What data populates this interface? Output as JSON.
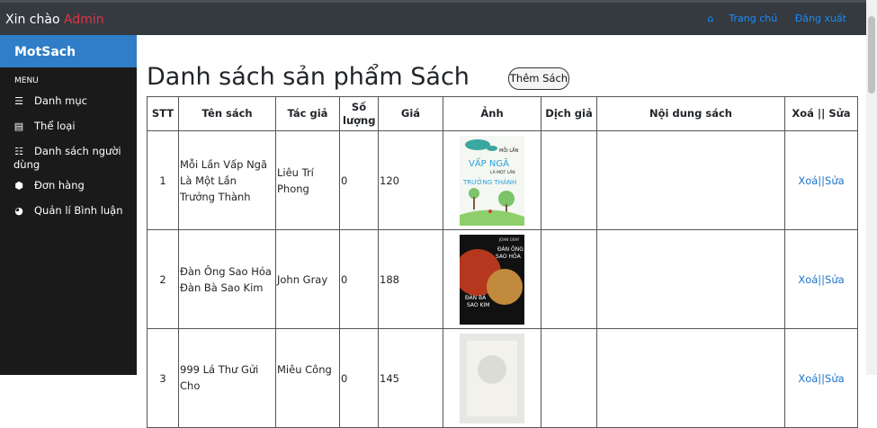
{
  "header": {
    "greeting": "Xin chào",
    "user": "Admin",
    "nav": [
      "Trang chủ",
      "Đăng xuất"
    ]
  },
  "sidebar": {
    "brand": "MotSach",
    "menu_heading": "MENU",
    "items": [
      {
        "label": "Danh mục",
        "icon": "list-icon"
      },
      {
        "label": "Thể loại",
        "icon": "category-icon"
      },
      {
        "label": "Danh sách người dùng",
        "icon": "users-list-icon"
      },
      {
        "label": "Đơn hàng",
        "icon": "order-icon"
      },
      {
        "label": "Quản lí Bình luận",
        "icon": "comments-icon"
      }
    ]
  },
  "main": {
    "title": "Danh sách sản phẩm Sách",
    "add_button": "Thêm Sách",
    "columns": [
      "STT",
      "Tên sách",
      "Tác giả",
      "Số lượng",
      "Giá",
      "Ảnh",
      "Dịch giả",
      "Nội dung sách",
      "Xoá || Sửa"
    ],
    "rows": [
      {
        "stt": "1",
        "name": "Mỗi Lần Vấp Ngã Là Một Lần Trưởng Thành",
        "author": "Liêu Trí Phong",
        "qty": "0",
        "price": "120",
        "cover_text": [
          "MỖI LẦN",
          "VẤP NGÃ",
          "LÀ MỘT LẦN",
          "TRƯỞNG THÀNH"
        ],
        "translator": "",
        "content": "",
        "delete": "Xoá",
        "sep": "||",
        "edit": "Sửa"
      },
      {
        "stt": "2",
        "name": "Đàn Ông Sao Hỏa Đàn Bà Sao Kim",
        "author": "John Gray",
        "qty": "0",
        "price": "188",
        "cover_text": [
          "JOHN GRAY",
          "ĐÀN ÔNG",
          "SAO HỎA",
          "ĐÀN BÀ",
          "SAO KIM"
        ],
        "translator": "",
        "content": "",
        "delete": "Xoá",
        "sep": "||",
        "edit": "Sửa"
      },
      {
        "stt": "3",
        "name": "999 Lá Thư Gửi Cho",
        "author": "Miêu Công",
        "qty": "0",
        "price": "145",
        "cover_text": [],
        "translator": "",
        "content": "",
        "delete": "Xoá",
        "sep": "||",
        "edit": "Sửa"
      }
    ]
  },
  "colors": {
    "topbar": "#343a40",
    "sidebar": "#1a1a1a",
    "brand": "#2f7ec7",
    "link": "#1a8cff",
    "admin": "#dc3545"
  }
}
